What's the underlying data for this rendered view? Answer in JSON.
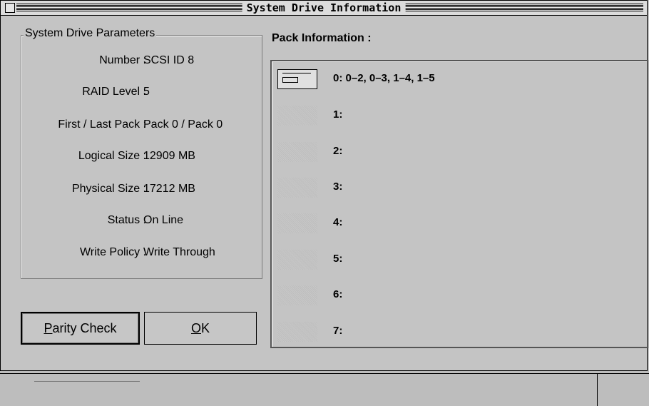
{
  "window": {
    "title": "System Drive Information"
  },
  "params": {
    "group_title": "System Drive Parameters",
    "rows": [
      {
        "label": "Number :",
        "value": "SCSI ID 8"
      },
      {
        "label": "RAID Level :",
        "value": "5"
      },
      {
        "label": "First / Last Pack :",
        "value": "Pack 0 / Pack 0"
      },
      {
        "label": "Logical Size :",
        "value": "12909 MB"
      },
      {
        "label": "Physical Size :",
        "value": "17212 MB"
      },
      {
        "label": "Status :",
        "value": "On Line"
      },
      {
        "label": "Write Policy :",
        "value": "Write Through"
      }
    ]
  },
  "pack": {
    "title": "Pack Information :",
    "items": [
      "0:  0–2, 0–3, 1–4, 1–5",
      "1:",
      "2:",
      "3:",
      "4:",
      "5:",
      "6:",
      "7:"
    ]
  },
  "buttons": {
    "parity_first": "P",
    "parity_rest": "arity Check",
    "ok_first": "O",
    "ok_rest": "K"
  }
}
